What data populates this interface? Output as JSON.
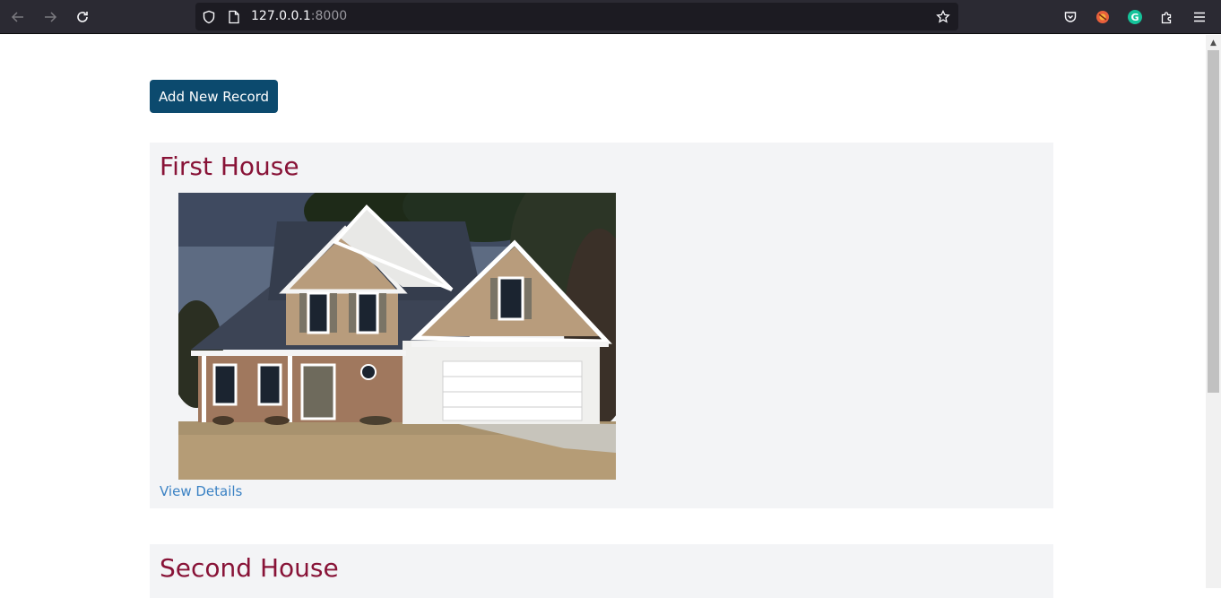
{
  "browser": {
    "url_host": "127.0.0.1",
    "url_port": ":8000",
    "icons": {
      "back": "back-arrow-icon",
      "forward": "forward-arrow-icon",
      "reload": "reload-icon",
      "shield": "shield-icon",
      "page": "page-icon",
      "bookmark": "star-icon",
      "pocket": "pocket-icon",
      "extension1": "extension-icon",
      "grammarly": "grammarly-icon",
      "extensions": "puzzle-icon",
      "menu": "hamburger-menu-icon"
    }
  },
  "page": {
    "add_button_label": "Add New Record",
    "records": [
      {
        "title": "First House",
        "link_label": "View Details"
      },
      {
        "title": "Second House"
      }
    ]
  },
  "colors": {
    "accent_button": "#0c4a6e",
    "title": "#881337",
    "link": "#3b82c4",
    "card_bg": "#f3f4f6"
  }
}
